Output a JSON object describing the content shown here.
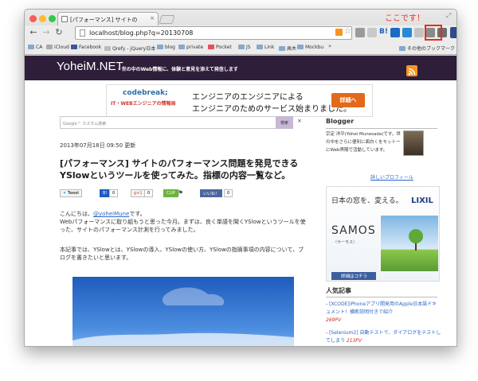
{
  "callout": "ここです！",
  "tab": {
    "title": "[パフォーマンス] サイトの"
  },
  "address": {
    "url": "localhost/blog.php?q=20130708"
  },
  "bookmarks": [
    {
      "label": "CA"
    },
    {
      "label": "iCloud"
    },
    {
      "label": "Facebook"
    },
    {
      "label": "Qrefy - jQuery日本"
    },
    {
      "label": "blog"
    },
    {
      "label": "private"
    },
    {
      "label": "Pocket"
    },
    {
      "label": "JS"
    },
    {
      "label": "Link"
    },
    {
      "label": "高木"
    },
    {
      "label": "Mockbu"
    }
  ],
  "bookmarks_other": "その他のブックマーク",
  "site": {
    "logo": "YoheiM.NET",
    "tagline": "- 世の中のWeb情報に、体験と意見を添えて発信します"
  },
  "ad": {
    "brand": "codebreak;",
    "brand_sub": "IT・WEBエンジニアの情報局",
    "line1": "エンジニアのエンジニアによる",
    "line2": "エンジニアのためのサービス始まりました。",
    "button": "詳細へ"
  },
  "search": {
    "placeholder": "Google™ カスタム検索",
    "button": "検索",
    "close": "×"
  },
  "post": {
    "date": "2013年07月18日 09:50 更新",
    "title": "[パフォーマンス] サイトのパフォーマンス問題を発見できるYSlowというツールを使ってみた。指標の内容一覧など。",
    "para1_prefix": "こんにちは、",
    "para1_link": "@yoheiMune",
    "para1_suffix": "です。",
    "para1_rest": "Webパフォーマンスに取り組もうと思った今月。まずは、良く単語を聞くYSlowというツールを使った、サイトのパフォーマンス計測を行ってみました。",
    "para2": "本記事では、YSlowとは、YSlowの導入、YSlowの使い方、YSlowの指摘事項の内容について、ブログを書きたいと思います。"
  },
  "social": {
    "tweet": "Tweet",
    "hatena_count": "0",
    "gplus": "g+1",
    "gplus_count": "0",
    "clip": "CLIP",
    "like": "いいね！",
    "like_count": "0"
  },
  "sidebar": {
    "blogger_title": "Blogger",
    "bio": "宗定 洋平(Yohei Munesada)です。世の中をさらに便利に面白くをモットーにWeb界隈で活動しています。",
    "profile_link": "詳しいプロフィール",
    "lixil": {
      "headline": "日本の窓を、変える。",
      "logo": "LIXIL",
      "product": "SAMOS II",
      "product_sub": "〈サーモス〉",
      "detail": "詳細はコチラ"
    },
    "popular_title": "人気記事",
    "popular": [
      {
        "title": "[XCODE]iPhoneアプリ開発用のApple日本語ドキュメント！横断説明付きで紹介",
        "pv": "269PV"
      },
      {
        "title": "[Selenium2] 自動テストで、ダイアログをテストしてしまう",
        "pv": "213PV"
      }
    ]
  },
  "colors": {
    "site_header": "#2f1e3a",
    "accent_red": "#e83018",
    "link": "#2a67c6"
  }
}
